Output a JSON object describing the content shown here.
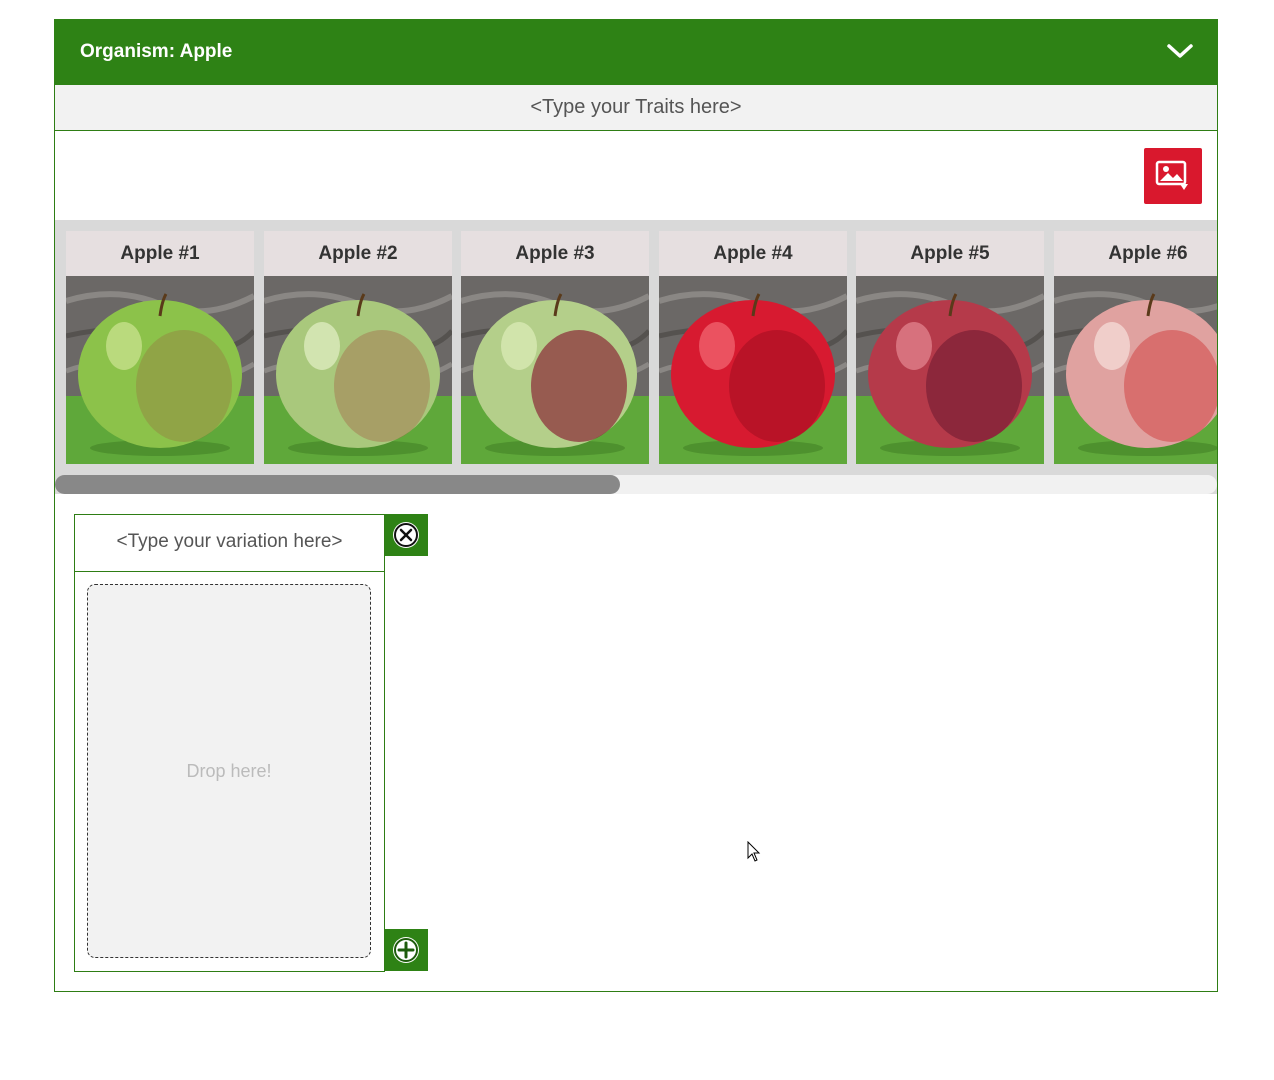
{
  "organism": {
    "title": "Organism: Apple"
  },
  "traits": {
    "placeholder": "<Type your Traits here>"
  },
  "gallery": {
    "items": [
      {
        "label": "Apple #1"
      },
      {
        "label": "Apple #2"
      },
      {
        "label": "Apple #3"
      },
      {
        "label": "Apple #4"
      },
      {
        "label": "Apple #5"
      },
      {
        "label": "Apple #6"
      }
    ]
  },
  "variation": {
    "placeholder": "<Type your variation here>",
    "drop_text": "Drop here!"
  },
  "icons": {
    "header_toggle": "chevron-down-icon",
    "image_button": "image-download-icon",
    "remove": "close-circle-icon",
    "add": "plus-circle-icon"
  },
  "colors": {
    "primary_green": "#2e8215",
    "image_button_red": "#d9182d"
  }
}
